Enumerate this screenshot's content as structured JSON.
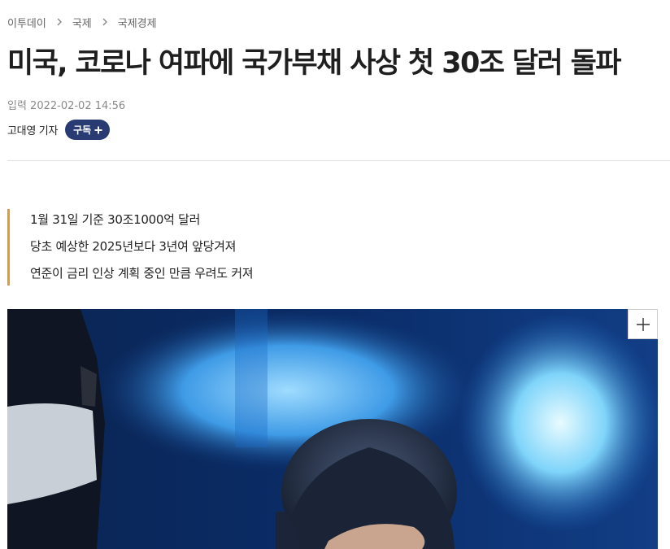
{
  "breadcrumb": {
    "items": [
      "이투데이",
      "국제",
      "국제경제"
    ]
  },
  "article": {
    "title": "미국, 코로나 여파에 국가부채 사상 첫 30조 달러 돌파",
    "date": "입력 2022-02-02 14:56",
    "author": "고대영 기자",
    "subscribe_label": "구독",
    "summary": [
      "1월 31일 기준 30조1000억 달러",
      "당초 예상한 2025년보다 3년여 앞당겨져",
      "연준이 금리 인상 계획 중인 만큼 우려도 커져"
    ]
  },
  "icons": {
    "breadcrumb_separator": "chevron-right-icon",
    "subscribe": "plus-icon",
    "photo_expand": "plus-icon"
  },
  "colors": {
    "subscribe_bg": "#283b73",
    "summary_accent": "#e39a2d"
  }
}
